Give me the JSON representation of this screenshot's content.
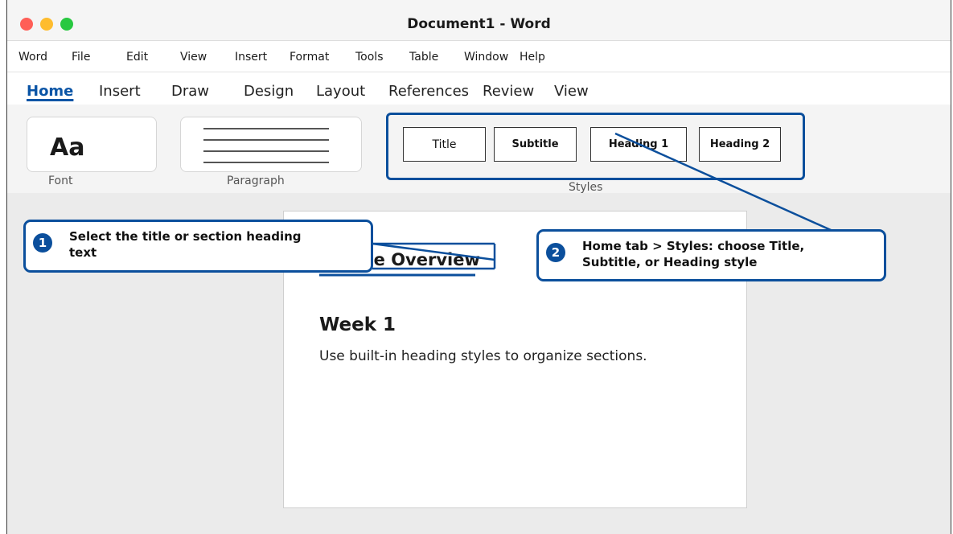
{
  "window": {
    "title": "Document1 - Word"
  },
  "menubar": [
    "Word",
    "File",
    "Edit",
    "View",
    "Insert",
    "Format",
    "Tools",
    "Table",
    "Window",
    "Help"
  ],
  "ribbon_tabs": [
    "Home",
    "Insert",
    "Draw",
    "Design",
    "Layout",
    "References",
    "Review",
    "View"
  ],
  "active_tab": "Home",
  "ribbon": {
    "font_preview": "Aa",
    "font_label": "Font",
    "paragraph_label": "Paragraph",
    "styles_label": "Styles",
    "styles": [
      "Title",
      "Subtitle",
      "Heading 1",
      "Heading 2"
    ]
  },
  "document": {
    "title": "Course Overview",
    "heading": "Week 1",
    "body": "Use built-in heading styles to organize sections."
  },
  "callouts": [
    {
      "number": "1",
      "text": "Select the title or section heading text"
    },
    {
      "number": "2",
      "text": "Home tab > Styles: choose Title, Subtitle, or Heading style"
    }
  ],
  "colors": {
    "accent": "#0b4f9c",
    "active_tab": "#0b55a6"
  }
}
